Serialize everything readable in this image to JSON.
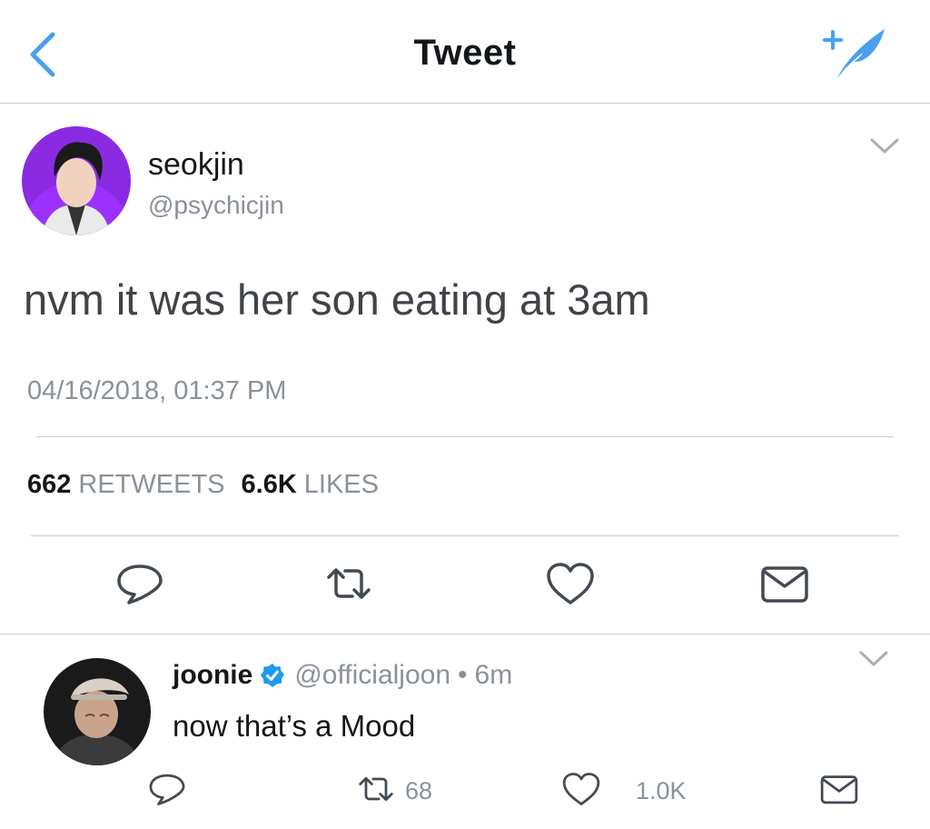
{
  "header": {
    "title": "Tweet",
    "back_icon": "chevron-left-icon",
    "compose_icon": "compose-quill-icon",
    "accent": "#4a9ff0"
  },
  "tweet": {
    "author_name": "seokjin",
    "author_handle": "@psychicjin",
    "text": "nvm it was her son eating at 3am",
    "timestamp": "04/16/2018, 01:37 PM",
    "retweets_count": "662",
    "retweets_label": "RETWEETS",
    "likes_count": "6.6K",
    "likes_label": "LIKES",
    "actions": [
      "reply-icon",
      "retweet-icon",
      "like-icon",
      "message-icon"
    ]
  },
  "reply": {
    "author_name": "joonie",
    "author_handle": "@officialjoon",
    "separator": "•",
    "time": "6m",
    "text": "now that’s a Mood",
    "retweets_count": "68",
    "likes_count": "1.0K"
  }
}
